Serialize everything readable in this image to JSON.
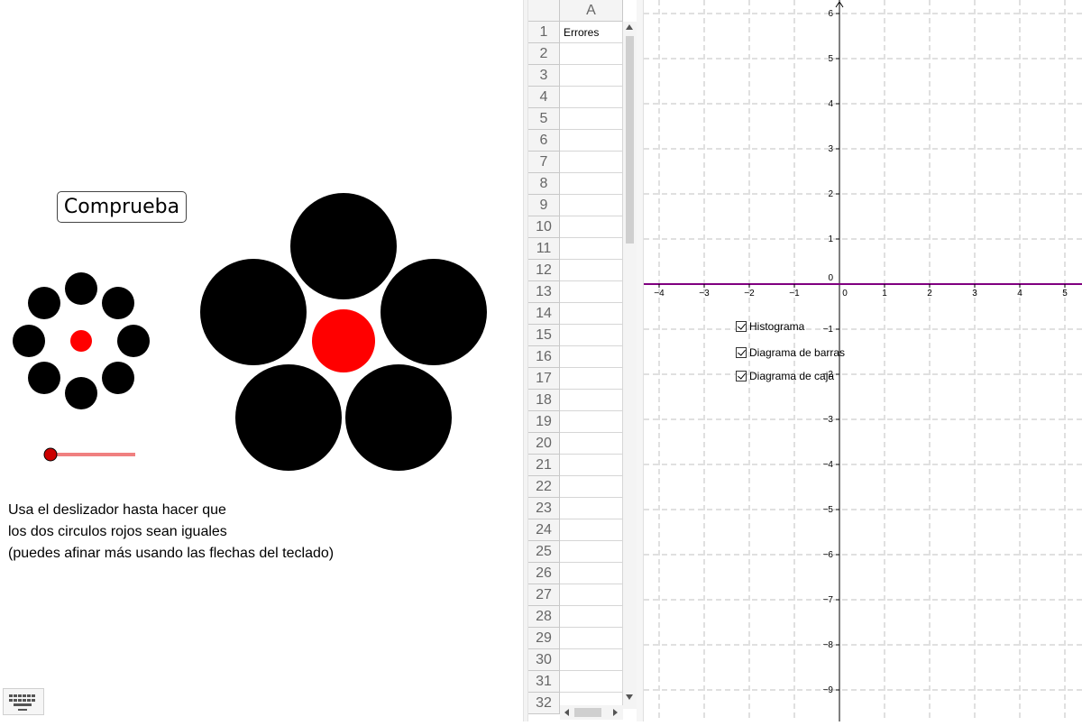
{
  "left_panel": {
    "check_button_label": "Comprueba",
    "instructions": [
      "Usa el deslizador hasta hacer que",
      "los dos circulos rojos sean iguales",
      "(puedes afinar más usando las flechas del teclado)"
    ],
    "slider": {
      "value_fraction": 0.0
    },
    "keyboard_icon": "keyboard-icon"
  },
  "spreadsheet": {
    "column_header": "A",
    "rows": [
      {
        "num": "1",
        "A": "Errores"
      },
      {
        "num": "2",
        "A": ""
      },
      {
        "num": "3",
        "A": ""
      },
      {
        "num": "4",
        "A": ""
      },
      {
        "num": "5",
        "A": ""
      },
      {
        "num": "6",
        "A": ""
      },
      {
        "num": "7",
        "A": ""
      },
      {
        "num": "8",
        "A": ""
      },
      {
        "num": "9",
        "A": ""
      },
      {
        "num": "10",
        "A": ""
      },
      {
        "num": "11",
        "A": ""
      },
      {
        "num": "12",
        "A": ""
      },
      {
        "num": "13",
        "A": ""
      },
      {
        "num": "14",
        "A": ""
      },
      {
        "num": "15",
        "A": ""
      },
      {
        "num": "16",
        "A": ""
      },
      {
        "num": "17",
        "A": ""
      },
      {
        "num": "18",
        "A": ""
      },
      {
        "num": "19",
        "A": ""
      },
      {
        "num": "20",
        "A": ""
      },
      {
        "num": "21",
        "A": ""
      },
      {
        "num": "22",
        "A": ""
      },
      {
        "num": "23",
        "A": ""
      },
      {
        "num": "24",
        "A": ""
      },
      {
        "num": "25",
        "A": ""
      },
      {
        "num": "26",
        "A": ""
      },
      {
        "num": "27",
        "A": ""
      },
      {
        "num": "28",
        "A": ""
      },
      {
        "num": "29",
        "A": ""
      },
      {
        "num": "30",
        "A": ""
      },
      {
        "num": "31",
        "A": ""
      },
      {
        "num": "32",
        "A": ""
      }
    ]
  },
  "graph": {
    "x_ticks": [
      "−4",
      "−3",
      "−2",
      "−1",
      "0",
      "1",
      "2",
      "3",
      "4",
      "5"
    ],
    "y_ticks": [
      "6",
      "5",
      "4",
      "3",
      "2",
      "1",
      "−1",
      "−2",
      "−3",
      "−4",
      "−5",
      "−6",
      "−7",
      "−8",
      "−9"
    ],
    "x_range": [
      -4.3,
      5.4
    ],
    "y_range": [
      -9.7,
      6.3
    ],
    "grid": true,
    "x_axis_color": "#800080",
    "checkboxes": [
      {
        "label": "Histograma",
        "checked": true
      },
      {
        "label": "Diagrama de barras",
        "checked": true
      },
      {
        "label": "Diagrama de caja",
        "checked": true
      }
    ]
  },
  "colors": {
    "red": "#ff0000",
    "black": "#000000",
    "slider_track": "#f08080"
  }
}
